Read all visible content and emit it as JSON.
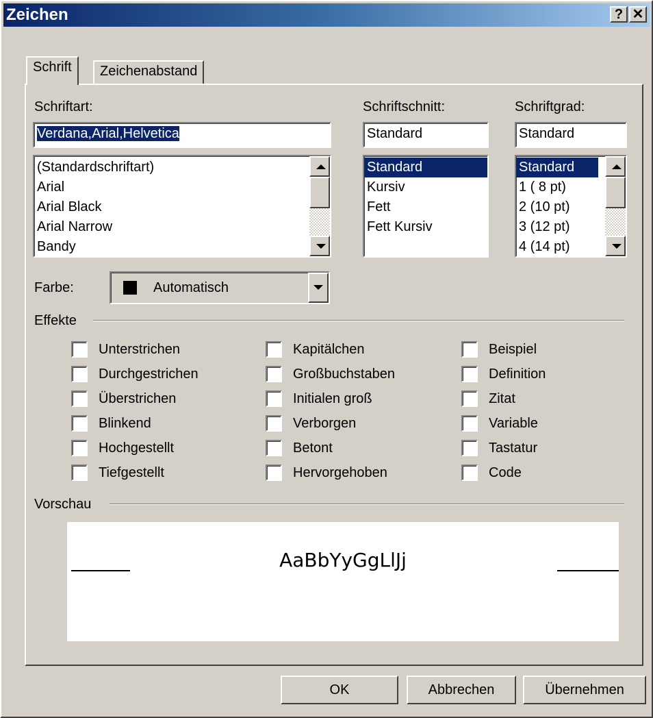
{
  "window": {
    "title": "Zeichen",
    "help_label": "?",
    "close_label": "✕"
  },
  "tabs": [
    {
      "label": "Schrift",
      "active": true
    },
    {
      "label": "Zeichenabstand",
      "active": false
    }
  ],
  "font": {
    "label": "Schriftart:",
    "value": "Verdana,Arial,Helvetica",
    "items": [
      "(Standardschriftart)",
      "Arial",
      "Arial Black",
      "Arial Narrow",
      "Bandy"
    ]
  },
  "style": {
    "label": "Schriftschnitt:",
    "value": "Standard",
    "items": [
      "Standard",
      "Kursiv",
      "Fett",
      "Fett Kursiv"
    ],
    "selected": "Standard"
  },
  "size": {
    "label": "Schriftgrad:",
    "value": "Standard",
    "items": [
      "Standard",
      "1  ( 8 pt)",
      "2  (10 pt)",
      "3  (12 pt)",
      "4  (14 pt)"
    ],
    "selected": "Standard"
  },
  "color": {
    "label": "Farbe:",
    "value": "Automatisch",
    "swatch": "#000000"
  },
  "effects": {
    "label": "Effekte",
    "col1": [
      "Unterstrichen",
      "Durchgestrichen",
      "Überstrichen",
      "Blinkend",
      "Hochgestellt",
      "Tiefgestellt"
    ],
    "col2": [
      "Kapitälchen",
      "Großbuchstaben",
      "Initialen groß",
      "Verborgen",
      "Betont",
      "Hervorgehoben"
    ],
    "col3": [
      "Beispiel",
      "Definition",
      "Zitat",
      "Variable",
      "Tastatur",
      "Code"
    ]
  },
  "preview": {
    "label": "Vorschau",
    "sample": "AaBbYyGgLlJj"
  },
  "buttons": {
    "ok": "OK",
    "cancel": "Abbrechen",
    "apply": "Übernehmen"
  },
  "colors": {
    "titlebar_start": "#0a246a",
    "titlebar_end": "#a6caf0",
    "face": "#d4d0c8",
    "selection": "#0a246a"
  }
}
